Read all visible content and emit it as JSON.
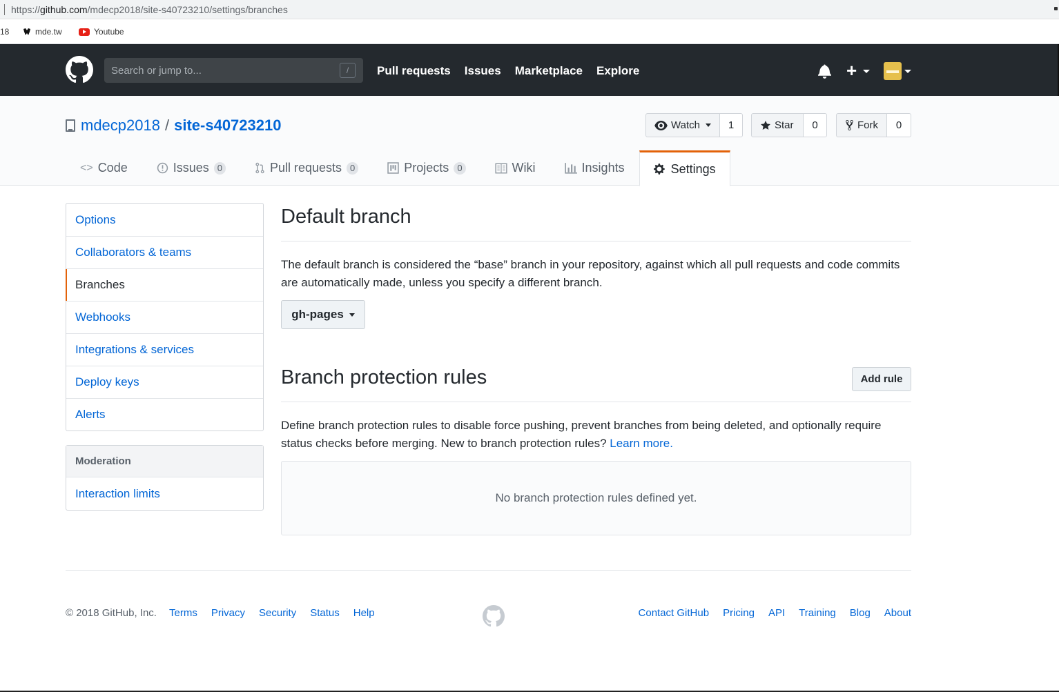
{
  "browser": {
    "url_prefix": "https://",
    "url_host": "github.com",
    "url_path": "/mdecp2018/site-s40723210/settings/branches",
    "bookmarks": [
      "18",
      "mde.tw",
      "Youtube"
    ]
  },
  "header": {
    "search_placeholder": "Search or jump to...",
    "search_shortcut": "/",
    "nav": [
      "Pull requests",
      "Issues",
      "Marketplace",
      "Explore"
    ]
  },
  "repo": {
    "owner": "mdecp2018",
    "separator": "/",
    "name": "site-s40723210",
    "watch": {
      "label": "Watch",
      "count": "1"
    },
    "star": {
      "label": "Star",
      "count": "0"
    },
    "fork": {
      "label": "Fork",
      "count": "0"
    }
  },
  "tabs": [
    {
      "label": "Code",
      "icon": "code-icon"
    },
    {
      "label": "Issues",
      "count": "0",
      "icon": "issue-icon"
    },
    {
      "label": "Pull requests",
      "count": "0",
      "icon": "pull-request-icon"
    },
    {
      "label": "Projects",
      "count": "0",
      "icon": "project-icon"
    },
    {
      "label": "Wiki",
      "icon": "book-icon"
    },
    {
      "label": "Insights",
      "icon": "graph-icon"
    },
    {
      "label": "Settings",
      "icon": "gear-icon",
      "active": true
    }
  ],
  "sidebar": {
    "items": [
      "Options",
      "Collaborators & teams",
      "Branches",
      "Webhooks",
      "Integrations & services",
      "Deploy keys",
      "Alerts"
    ],
    "selected": "Branches",
    "moderation_heading": "Moderation",
    "moderation_items": [
      "Interaction limits"
    ]
  },
  "default_branch": {
    "title": "Default branch",
    "description": "The default branch is considered the “base” branch in your repository, against which all pull requests and code commits are automatically made, unless you specify a different branch.",
    "branch": "gh-pages"
  },
  "protection": {
    "title": "Branch protection rules",
    "add_rule": "Add rule",
    "description": "Define branch protection rules to disable force pushing, prevent branches from being deleted, and optionally require status checks before merging. New to branch protection rules?",
    "learn_more": "Learn more.",
    "empty": "No branch protection rules defined yet."
  },
  "footer": {
    "copyright": "© 2018 GitHub, Inc.",
    "left_links": [
      "Terms",
      "Privacy",
      "Security",
      "Status",
      "Help"
    ],
    "right_links": [
      "Contact GitHub",
      "Pricing",
      "API",
      "Training",
      "Blog",
      "About"
    ]
  },
  "colors": {
    "header_bg": "#24292e",
    "link": "#0366d6",
    "accent": "#e36209"
  }
}
